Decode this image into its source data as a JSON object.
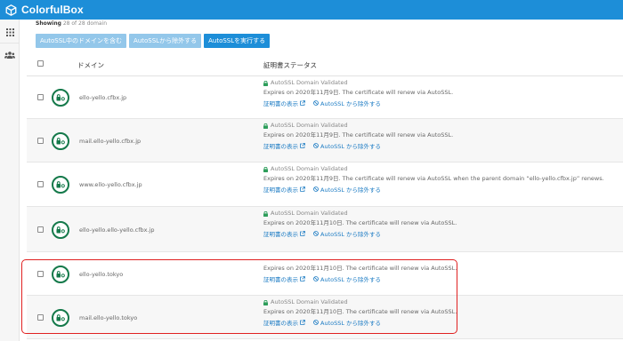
{
  "app": {
    "title": "ColorfulBox",
    "logo_icon": "cube-icon"
  },
  "colors": {
    "brand": "#1d8ed8",
    "success": "#14794a",
    "link": "#1d7cc4",
    "highlight": "#e02020"
  },
  "sidebar": {
    "items": [
      {
        "icon": "apps-grid-icon"
      },
      {
        "icon": "users-icon"
      }
    ]
  },
  "showing": {
    "prefix": "Showing",
    "suffix": "28 of 28 domain"
  },
  "actions": {
    "include_label": "AutoSSL中のドメインを含む",
    "exclude_label": "AutoSSLから除外する",
    "run_label": "AutoSSLを実行する"
  },
  "table": {
    "headers": {
      "domain": "ドメイン",
      "status": "証明書ステータス"
    },
    "rows": [
      {
        "domain": "ello-yello.cfbx.jp",
        "status": "AutoSSL Domain Validated",
        "expires": "Expires on 2020年11月9日. The certificate will renew via AutoSSL.",
        "view_label": "証明書の表示",
        "exclude_label": "AutoSSL から除外する"
      },
      {
        "domain": "mail.ello-yello.cfbx.jp",
        "status": "AutoSSL Domain Validated",
        "expires": "Expires on 2020年11月9日. The certificate will renew via AutoSSL.",
        "view_label": "証明書の表示",
        "exclude_label": "AutoSSL から除外する"
      },
      {
        "domain": "www.ello-yello.cfbx.jp",
        "status": "AutoSSL Domain Validated",
        "expires": "Expires on 2020年11月9日. The certificate will renew via AutoSSL when the parent domain “ello-yello.cfbx.jp” renews.",
        "view_label": "証明書の表示",
        "exclude_label": "AutoSSL から除外する"
      },
      {
        "domain": "ello-yello.ello-yello.cfbx.jp",
        "status": "AutoSSL Domain Validated",
        "expires": "Expires on 2020年11月10日. The certificate will renew via AutoSSL.",
        "view_label": "証明書の表示",
        "exclude_label": "AutoSSL から除外する"
      },
      {
        "domain": "ello-yello.tokyo",
        "status": "",
        "expires": "Expires on 2020年11月10日. The certificate will renew via AutoSSL.",
        "view_label": "証明書の表示",
        "exclude_label": "AutoSSL から除外する"
      },
      {
        "domain": "mail.ello-yello.tokyo",
        "status": "AutoSSL Domain Validated",
        "expires": "Expires on 2020年11月10日. The certificate will renew via AutoSSL.",
        "view_label": "証明書の表示",
        "exclude_label": "AutoSSL から除外する"
      }
    ]
  }
}
